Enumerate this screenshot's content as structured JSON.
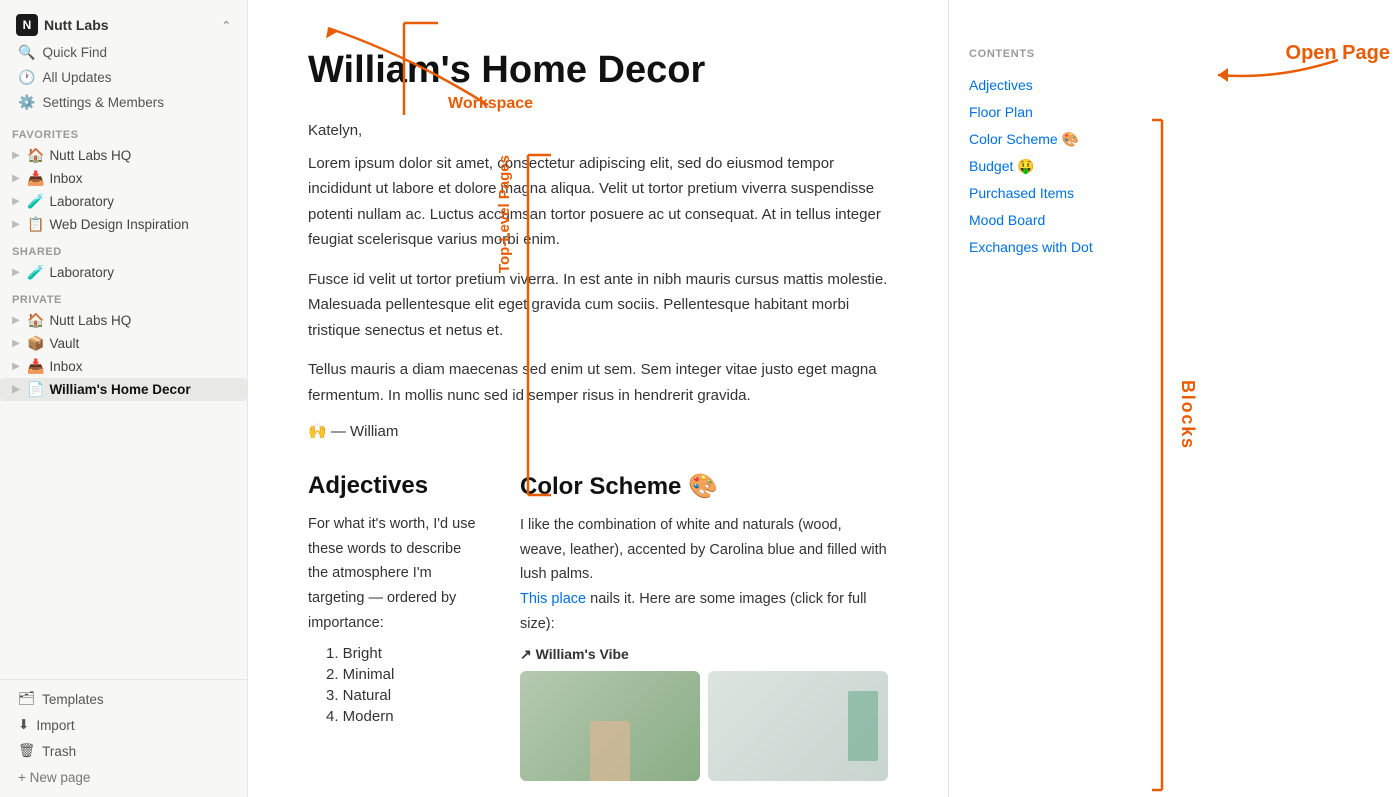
{
  "workspace": {
    "name": "Nutt Labs",
    "icon_letter": "N",
    "label": "Workspace"
  },
  "nav": {
    "quick_find": "Quick Find",
    "all_updates": "All Updates",
    "settings": "Settings & Members"
  },
  "sidebar": {
    "favorites_label": "Favorites",
    "shared_label": "Shared",
    "private_label": "Private",
    "favorites": [
      {
        "label": "Nutt Labs HQ",
        "icon": "🏠",
        "type": "icon"
      },
      {
        "label": "Inbox",
        "icon": "📥",
        "type": "icon"
      },
      {
        "label": "Laboratory",
        "icon": "🧪",
        "type": "icon"
      },
      {
        "label": "Web Design Inspiration",
        "icon": "📋",
        "type": "icon"
      }
    ],
    "shared": [
      {
        "label": "Laboratory",
        "icon": "🧪",
        "type": "icon"
      }
    ],
    "private": [
      {
        "label": "Nutt Labs HQ",
        "icon": "🏠",
        "type": "icon"
      },
      {
        "label": "Vault",
        "icon": "📦",
        "type": "icon"
      },
      {
        "label": "Inbox",
        "icon": "📥",
        "type": "icon"
      },
      {
        "label": "William's Home Decor",
        "icon": "📄",
        "type": "icon",
        "active": true
      }
    ],
    "bottom": {
      "templates": "Templates",
      "import": "Import",
      "trash": "Trash"
    },
    "new_page": "+ New page"
  },
  "page": {
    "title": "William's Home Decor",
    "greeting": "Katelyn,",
    "body1": "Lorem ipsum dolor sit amet, consectetur adipiscing elit, sed do eiusmod tempor incididunt ut labore et dolore magna aliqua. Velit ut tortor pretium viverra suspendisse potenti nullam ac. Luctus accumsan tortor posuere ac ut consequat. At in tellus integer feugiat scelerisque varius morbi enim.",
    "body2": "Fusce id velit ut tortor pretium viverra. In est ante in nibh mauris cursus mattis molestie. Malesuada pellentesque elit eget gravida cum sociis. Pellentesque habitant morbi tristique senectus et netus et.",
    "body3": "Tellus mauris a diam maecenas sed enim ut sem. Sem integer vitae justo eget magna fermentum. In mollis nunc sed id semper risus in hendrerit gravida.",
    "signature": "🙌 — William"
  },
  "contents": {
    "heading": "CONTENTS",
    "links": [
      "Adjectives",
      "Floor Plan",
      "Color Scheme 🎨",
      "Budget 🤑",
      "Purchased Items",
      "Mood Board",
      "Exchanges with Dot"
    ]
  },
  "subpage_adjectives": {
    "heading": "Adjectives",
    "body": "For what it's worth, I'd use these words to describe the atmosphere I'm targeting — ordered by importance:",
    "list": [
      "Bright",
      "Minimal",
      "Natural",
      "Modern"
    ]
  },
  "subpage_color": {
    "heading": "Color Scheme 🎨",
    "body1": "I like the combination of white and naturals (wood, weave, leather), accented by Carolina blue and filled with lush palms.",
    "link_text": "This place",
    "body2": " nails it. Here are some images (click for full size):",
    "vibe_label": "↗ William's Vibe"
  },
  "annotations": {
    "workspace_label": "Workspace",
    "open_page_label": "Open Page",
    "top_level_label": "Top-Level Pages",
    "blocks_label": "Blocks"
  }
}
